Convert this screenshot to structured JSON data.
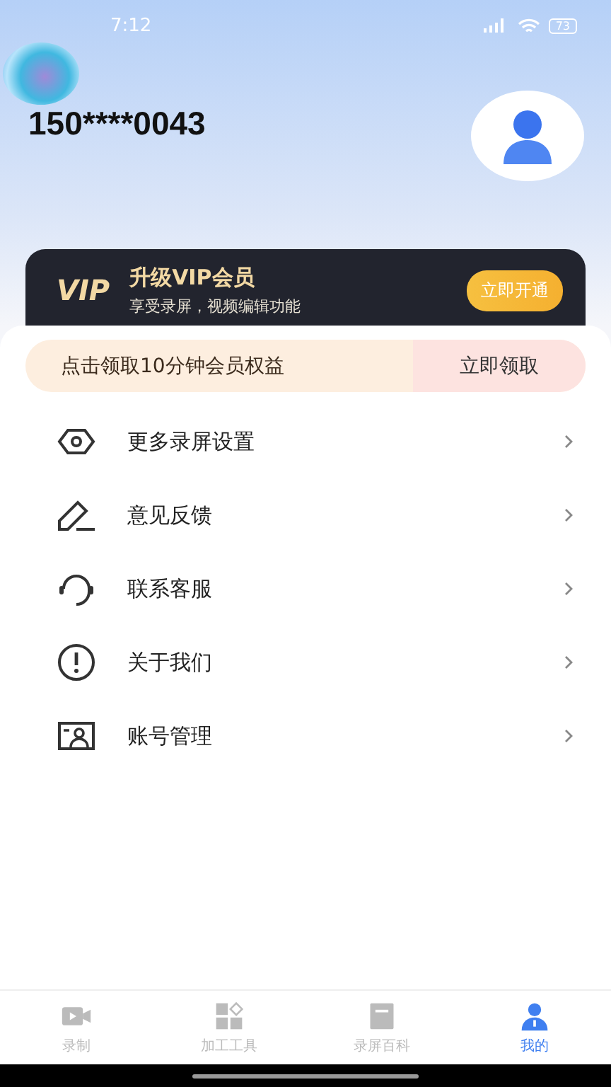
{
  "status_bar": {
    "time": "7:12",
    "battery": "73"
  },
  "profile": {
    "phone": "150****0043"
  },
  "vip_card": {
    "badge": "VIP",
    "title": "升级VIP会员",
    "subtitle": "享受录屏，视频编辑功能",
    "button": "立即开通"
  },
  "claim_banner": {
    "text": "点击领取10分钟会员权益",
    "button": "立即领取"
  },
  "menu": [
    {
      "kind": "settings",
      "label": "更多录屏设置"
    },
    {
      "kind": "feedback",
      "label": "意见反馈"
    },
    {
      "kind": "support",
      "label": "联系客服"
    },
    {
      "kind": "about",
      "label": "关于我们"
    },
    {
      "kind": "account",
      "label": "账号管理"
    }
  ],
  "tab_bar": [
    {
      "kind": "record",
      "label": "录制",
      "selected": false
    },
    {
      "kind": "tools",
      "label": "加工工具",
      "selected": false
    },
    {
      "kind": "wiki",
      "label": "录屏百科",
      "selected": false
    },
    {
      "kind": "me",
      "label": "我的",
      "selected": true
    }
  ]
}
